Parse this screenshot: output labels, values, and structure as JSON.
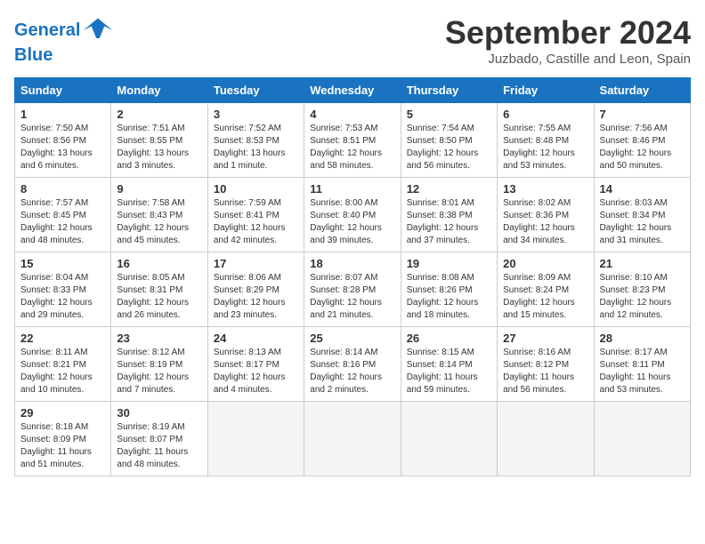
{
  "header": {
    "logo_line1": "General",
    "logo_line2": "Blue",
    "title": "September 2024",
    "subtitle": "Juzbado, Castille and Leon, Spain"
  },
  "days_of_week": [
    "Sunday",
    "Monday",
    "Tuesday",
    "Wednesday",
    "Thursday",
    "Friday",
    "Saturday"
  ],
  "weeks": [
    [
      {
        "day": "1",
        "sunrise": "Sunrise: 7:50 AM",
        "sunset": "Sunset: 8:56 PM",
        "daylight": "Daylight: 13 hours and 6 minutes."
      },
      {
        "day": "2",
        "sunrise": "Sunrise: 7:51 AM",
        "sunset": "Sunset: 8:55 PM",
        "daylight": "Daylight: 13 hours and 3 minutes."
      },
      {
        "day": "3",
        "sunrise": "Sunrise: 7:52 AM",
        "sunset": "Sunset: 8:53 PM",
        "daylight": "Daylight: 13 hours and 1 minute."
      },
      {
        "day": "4",
        "sunrise": "Sunrise: 7:53 AM",
        "sunset": "Sunset: 8:51 PM",
        "daylight": "Daylight: 12 hours and 58 minutes."
      },
      {
        "day": "5",
        "sunrise": "Sunrise: 7:54 AM",
        "sunset": "Sunset: 8:50 PM",
        "daylight": "Daylight: 12 hours and 56 minutes."
      },
      {
        "day": "6",
        "sunrise": "Sunrise: 7:55 AM",
        "sunset": "Sunset: 8:48 PM",
        "daylight": "Daylight: 12 hours and 53 minutes."
      },
      {
        "day": "7",
        "sunrise": "Sunrise: 7:56 AM",
        "sunset": "Sunset: 8:46 PM",
        "daylight": "Daylight: 12 hours and 50 minutes."
      }
    ],
    [
      {
        "day": "8",
        "sunrise": "Sunrise: 7:57 AM",
        "sunset": "Sunset: 8:45 PM",
        "daylight": "Daylight: 12 hours and 48 minutes."
      },
      {
        "day": "9",
        "sunrise": "Sunrise: 7:58 AM",
        "sunset": "Sunset: 8:43 PM",
        "daylight": "Daylight: 12 hours and 45 minutes."
      },
      {
        "day": "10",
        "sunrise": "Sunrise: 7:59 AM",
        "sunset": "Sunset: 8:41 PM",
        "daylight": "Daylight: 12 hours and 42 minutes."
      },
      {
        "day": "11",
        "sunrise": "Sunrise: 8:00 AM",
        "sunset": "Sunset: 8:40 PM",
        "daylight": "Daylight: 12 hours and 39 minutes."
      },
      {
        "day": "12",
        "sunrise": "Sunrise: 8:01 AM",
        "sunset": "Sunset: 8:38 PM",
        "daylight": "Daylight: 12 hours and 37 minutes."
      },
      {
        "day": "13",
        "sunrise": "Sunrise: 8:02 AM",
        "sunset": "Sunset: 8:36 PM",
        "daylight": "Daylight: 12 hours and 34 minutes."
      },
      {
        "day": "14",
        "sunrise": "Sunrise: 8:03 AM",
        "sunset": "Sunset: 8:34 PM",
        "daylight": "Daylight: 12 hours and 31 minutes."
      }
    ],
    [
      {
        "day": "15",
        "sunrise": "Sunrise: 8:04 AM",
        "sunset": "Sunset: 8:33 PM",
        "daylight": "Daylight: 12 hours and 29 minutes."
      },
      {
        "day": "16",
        "sunrise": "Sunrise: 8:05 AM",
        "sunset": "Sunset: 8:31 PM",
        "daylight": "Daylight: 12 hours and 26 minutes."
      },
      {
        "day": "17",
        "sunrise": "Sunrise: 8:06 AM",
        "sunset": "Sunset: 8:29 PM",
        "daylight": "Daylight: 12 hours and 23 minutes."
      },
      {
        "day": "18",
        "sunrise": "Sunrise: 8:07 AM",
        "sunset": "Sunset: 8:28 PM",
        "daylight": "Daylight: 12 hours and 21 minutes."
      },
      {
        "day": "19",
        "sunrise": "Sunrise: 8:08 AM",
        "sunset": "Sunset: 8:26 PM",
        "daylight": "Daylight: 12 hours and 18 minutes."
      },
      {
        "day": "20",
        "sunrise": "Sunrise: 8:09 AM",
        "sunset": "Sunset: 8:24 PM",
        "daylight": "Daylight: 12 hours and 15 minutes."
      },
      {
        "day": "21",
        "sunrise": "Sunrise: 8:10 AM",
        "sunset": "Sunset: 8:23 PM",
        "daylight": "Daylight: 12 hours and 12 minutes."
      }
    ],
    [
      {
        "day": "22",
        "sunrise": "Sunrise: 8:11 AM",
        "sunset": "Sunset: 8:21 PM",
        "daylight": "Daylight: 12 hours and 10 minutes."
      },
      {
        "day": "23",
        "sunrise": "Sunrise: 8:12 AM",
        "sunset": "Sunset: 8:19 PM",
        "daylight": "Daylight: 12 hours and 7 minutes."
      },
      {
        "day": "24",
        "sunrise": "Sunrise: 8:13 AM",
        "sunset": "Sunset: 8:17 PM",
        "daylight": "Daylight: 12 hours and 4 minutes."
      },
      {
        "day": "25",
        "sunrise": "Sunrise: 8:14 AM",
        "sunset": "Sunset: 8:16 PM",
        "daylight": "Daylight: 12 hours and 2 minutes."
      },
      {
        "day": "26",
        "sunrise": "Sunrise: 8:15 AM",
        "sunset": "Sunset: 8:14 PM",
        "daylight": "Daylight: 11 hours and 59 minutes."
      },
      {
        "day": "27",
        "sunrise": "Sunrise: 8:16 AM",
        "sunset": "Sunset: 8:12 PM",
        "daylight": "Daylight: 11 hours and 56 minutes."
      },
      {
        "day": "28",
        "sunrise": "Sunrise: 8:17 AM",
        "sunset": "Sunset: 8:11 PM",
        "daylight": "Daylight: 11 hours and 53 minutes."
      }
    ],
    [
      {
        "day": "29",
        "sunrise": "Sunrise: 8:18 AM",
        "sunset": "Sunset: 8:09 PM",
        "daylight": "Daylight: 11 hours and 51 minutes."
      },
      {
        "day": "30",
        "sunrise": "Sunrise: 8:19 AM",
        "sunset": "Sunset: 8:07 PM",
        "daylight": "Daylight: 11 hours and 48 minutes."
      },
      null,
      null,
      null,
      null,
      null
    ]
  ]
}
